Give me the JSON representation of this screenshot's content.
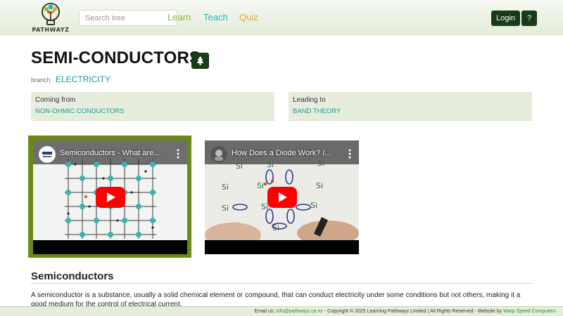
{
  "header": {
    "logo_text": "PATHWAYZ",
    "search_placeholder": "Search tree",
    "nav": {
      "learn": "Learn",
      "teach": "Teach",
      "quiz": "Quiz"
    },
    "login_label": "Login",
    "help_label": "?"
  },
  "topic": {
    "title": "SEMI-CONDUCTORS",
    "tree_icon": "tree-icon",
    "branch_label": "branch",
    "branch_value": "ELECTRICITY"
  },
  "relations": {
    "coming_from_label": "Coming from",
    "coming_from_value": "NON-OHMIC CONDUCTORS",
    "leading_to_label": "Leading to",
    "leading_to_value": "BAND THEORY"
  },
  "videos": [
    {
      "title": "Semiconductors - What are...",
      "icon": "channel-avatar"
    },
    {
      "title": "How Does a Diode Work? I...",
      "icon": "channel-avatar"
    }
  ],
  "content": {
    "heading": "Semiconductors",
    "body": "A semiconductor is a substance, usually a solid chemical element or compound, that can conduct electricity under some conditions but not others, making it a good medium for the control of electrical current."
  },
  "footer": {
    "email_prefix": "Email us: ",
    "email": "info@pathwayz.co.nz",
    "copyright": " - Copyright © 2025 Learning Pathwayz Limited | All Rights Reserved - Website by ",
    "credit": "Warp Speed Computers"
  },
  "colors": {
    "accent_dark": "#173a17",
    "learn": "#8fbc2f",
    "teach": "#22b5b0",
    "quiz": "#e8a22c",
    "link": "#1a9d95",
    "panel_bg": "#e6eddc",
    "video_highlight": "#6a8a16"
  }
}
